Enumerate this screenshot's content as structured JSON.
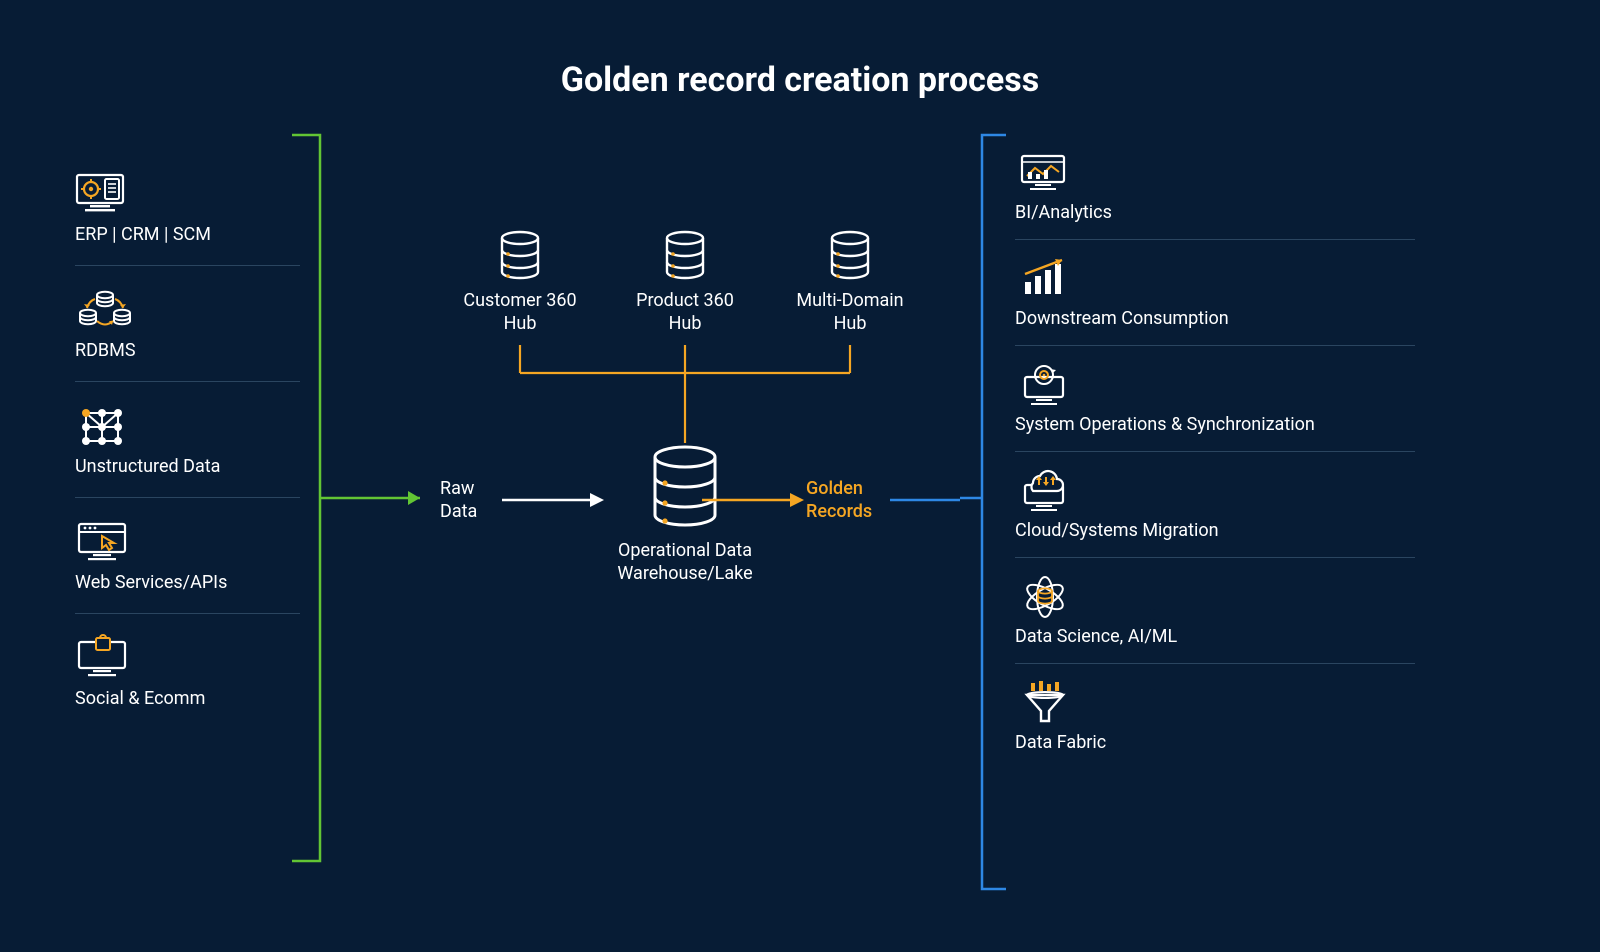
{
  "title": "Golden record creation process",
  "colors": {
    "bg": "#071c35",
    "orange": "#f5a623",
    "green": "#62c534",
    "blue": "#2e88e5",
    "white": "#ffffff",
    "divider": "#2a4560"
  },
  "flow": {
    "raw_label": "Raw\nData",
    "golden_label": "Golden\nRecords",
    "odw_label": "Operational Data\nWarehouse/Lake"
  },
  "hubs": [
    {
      "id": "customer-360-hub",
      "label": "Customer 360\nHub"
    },
    {
      "id": "product-360-hub",
      "label": "Product 360\nHub"
    },
    {
      "id": "multi-domain-hub",
      "label": "Multi-Domain\nHub"
    }
  ],
  "sources": [
    {
      "id": "erp-crm-scm",
      "icon": "gear-doc-monitor-icon",
      "label": "ERP | CRM | SCM"
    },
    {
      "id": "rdbms",
      "icon": "db-cluster-icon",
      "label": "RDBMS"
    },
    {
      "id": "unstructured-data",
      "icon": "nodes-icon",
      "label": "Unstructured Data"
    },
    {
      "id": "web-services-apis",
      "icon": "browser-pointer-icon",
      "label": "Web Services/APIs"
    },
    {
      "id": "social-ecomm",
      "icon": "bag-monitor-icon",
      "label": "Social & Ecomm"
    }
  ],
  "consumers": [
    {
      "id": "bi-analytics",
      "icon": "chart-monitor-icon",
      "label": "BI/Analytics"
    },
    {
      "id": "downstream-consume",
      "icon": "bars-trend-icon",
      "label": "Downstream Consumption"
    },
    {
      "id": "sys-ops-sync",
      "icon": "refresh-gear-icon",
      "label": "System Operations & Synchronization"
    },
    {
      "id": "cloud-migration",
      "icon": "cloud-arrows-icon",
      "label": "Cloud/Systems Migration"
    },
    {
      "id": "data-science-ai-ml",
      "icon": "atom-db-icon",
      "label": "Data Science, AI/ML"
    },
    {
      "id": "data-fabric",
      "icon": "funnel-icon",
      "label": "Data Fabric"
    }
  ]
}
